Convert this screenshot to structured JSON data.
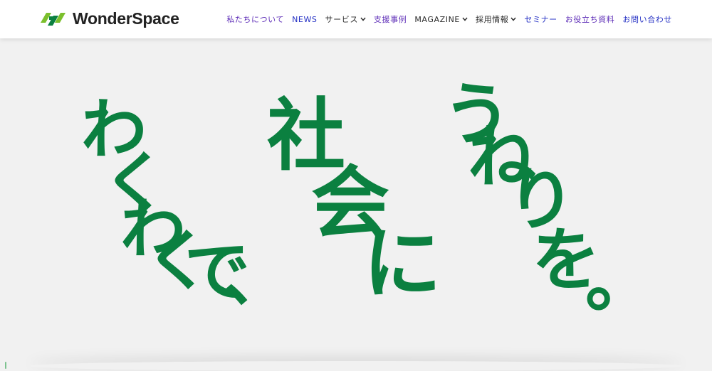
{
  "brand": {
    "name": "WonderSpace",
    "accent": "#7bbf2c",
    "accent_dark": "#0b8040"
  },
  "nav": {
    "items": [
      {
        "label": "私たちについて",
        "color": "purple",
        "has_dropdown": false
      },
      {
        "label": "NEWS",
        "color": "blue",
        "has_dropdown": false
      },
      {
        "label": "サービス",
        "color": "dark",
        "has_dropdown": true
      },
      {
        "label": "支援事例",
        "color": "purple",
        "has_dropdown": false
      },
      {
        "label": "MAGAZINE",
        "color": "dark",
        "has_dropdown": true
      },
      {
        "label": "採用情報",
        "color": "dark",
        "has_dropdown": true
      },
      {
        "label": "セミナー",
        "color": "blue",
        "has_dropdown": false
      },
      {
        "label": "お役立ち資料",
        "color": "purple",
        "has_dropdown": false
      },
      {
        "label": "お問い合わせ",
        "color": "blue",
        "has_dropdown": false
      }
    ]
  },
  "hero": {
    "background": "#f1f1f1",
    "text_color": "#0b8040",
    "line1": "わくわくで、",
    "line2": "社会に",
    "line3": "うねりを。"
  }
}
